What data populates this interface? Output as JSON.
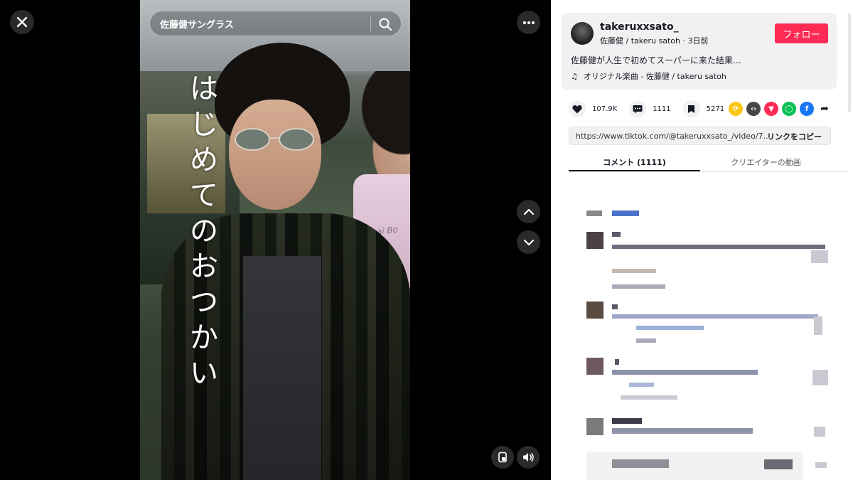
{
  "video": {
    "search_text": "佐藤健サングラス",
    "caption": "はじめてのおつかい",
    "truck_text": "Acai Bo"
  },
  "author": {
    "username": "takeruxxsato_",
    "display_line": "佐藤健 / takeru satoh · 3日前",
    "follow_label": "フォロー",
    "description": "佐藤健が人生で初めてスーパーに来た結果…",
    "music": "オリジナル楽曲 - 佐藤健 / takeru satoh"
  },
  "stats": {
    "likes": "107.9K",
    "comments": "1111",
    "saves": "5271"
  },
  "share_icons": [
    "repost-icon",
    "embed-icon",
    "send-icon",
    "line-icon",
    "facebook-icon",
    "share-arrow-icon"
  ],
  "link": {
    "url": "https://www.tiktok.com/@takeruxxsato_/video/7...",
    "copy_label": "リンクをコピー"
  },
  "tabs": {
    "comments": "コメント (1111)",
    "creator_videos": "クリエイターの動画"
  },
  "colors": {
    "follow_button": "#fe2c55",
    "panel_bg": "#ffffff",
    "card_bg": "#f1f1f2"
  }
}
